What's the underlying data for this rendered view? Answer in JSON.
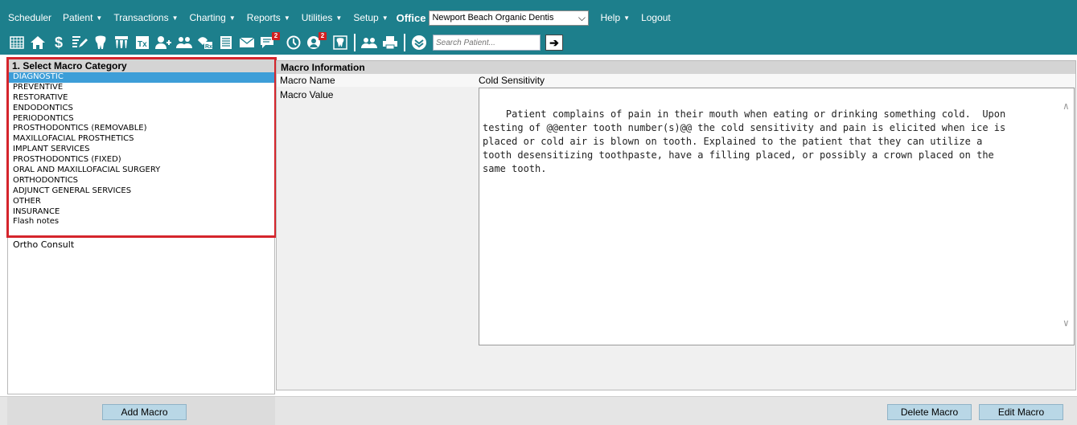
{
  "menu": {
    "items": [
      {
        "label": "Scheduler",
        "has_caret": false
      },
      {
        "label": "Patient",
        "has_caret": true
      },
      {
        "label": "Transactions",
        "has_caret": true
      },
      {
        "label": "Charting",
        "has_caret": true
      },
      {
        "label": "Reports",
        "has_caret": true
      },
      {
        "label": "Utilities",
        "has_caret": true
      },
      {
        "label": "Setup",
        "has_caret": true
      }
    ],
    "office_label": "Office",
    "office_value": "Newport Beach Organic Dentis",
    "help_label": "Help",
    "logout_label": "Logout"
  },
  "toolbar": {
    "icons": [
      "calendar-icon",
      "home-icon",
      "money-icon",
      "edit-icon",
      "tooth-icon",
      "teeth-icon",
      "treatment-icon",
      "add-patient-icon",
      "family-icon",
      "prescription-icon",
      "document-icon",
      "email-icon",
      "messages-icon",
      "clock-icon",
      "recall-icon",
      "tooth-chart-icon",
      "users-icon",
      "print-icon",
      "dropdown-circle-icon"
    ],
    "messages_badge": "2",
    "recall_badge": "2",
    "search_placeholder": "Search Patient..."
  },
  "left_panel": {
    "header": "1. Select Macro Category",
    "categories": [
      "DIAGNOSTIC",
      "PREVENTIVE",
      "RESTORATIVE",
      "ENDODONTICS",
      "PERIODONTICS",
      "PROSTHODONTICS (REMOVABLE)",
      "MAXILLOFACIAL PROSTHETICS",
      "IMPLANT SERVICES",
      "PROSTHODONTICS (FIXED)",
      "ORAL AND MAXILLOFACIAL SURGERY",
      "ORTHODONTICS",
      "ADJUNCT GENERAL SERVICES",
      "OTHER",
      "INSURANCE",
      "Flash notes"
    ],
    "selected_category": "DIAGNOSTIC",
    "macros": [
      "Ortho Consult"
    ],
    "add_button": "Add Macro"
  },
  "right_panel": {
    "header": "Macro Information",
    "name_label": "Macro Name",
    "name_value": "Cold Sensitivity",
    "value_label": "Macro Value",
    "value_text": "Patient complains of pain in their mouth when eating or drinking something cold.  Upon\ntesting of @@enter tooth number(s)@@ the cold sensitivity and pain is elicited when ice is\nplaced or cold air is blown on tooth. Explained to the patient that they can utilize a\ntooth desensitizing toothpaste, have a filling placed, or possibly a crown placed on the\nsame tooth.",
    "delete_button": "Delete Macro",
    "edit_button": "Edit Macro"
  },
  "colors": {
    "header_teal": "#1d7f8c",
    "selection_blue": "#3d9ed8",
    "highlight_red": "#d5252c",
    "button_blue": "#b9d7e6"
  }
}
